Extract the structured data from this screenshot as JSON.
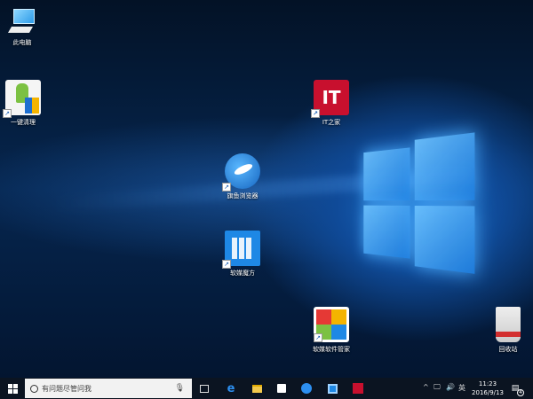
{
  "desktop": {
    "icons": [
      {
        "label": "此电脑",
        "icon": "computer-icon"
      },
      {
        "label": "一键清理",
        "icon": "cleanup-icon"
      },
      {
        "label": "IT之家",
        "icon": "ithome-icon",
        "badge": "IT"
      },
      {
        "label": "旗鱼浏览器",
        "icon": "sailfish-browser-icon"
      },
      {
        "label": "软媒魔方",
        "icon": "ruanmei-mofang-icon"
      },
      {
        "label": "软媒软件管家",
        "icon": "software-manager-icon"
      },
      {
        "label": "回收站",
        "icon": "recycle-bin-icon"
      }
    ]
  },
  "taskbar": {
    "search_placeholder": "有问题尽管问我",
    "tray": {
      "lang": "英",
      "time": "11:23",
      "date": "2016/9/13",
      "notifications": "4"
    }
  },
  "colors": {
    "taskbar": "#0b1421",
    "it_red": "#c8102e",
    "accent": "#1e7fe0"
  }
}
